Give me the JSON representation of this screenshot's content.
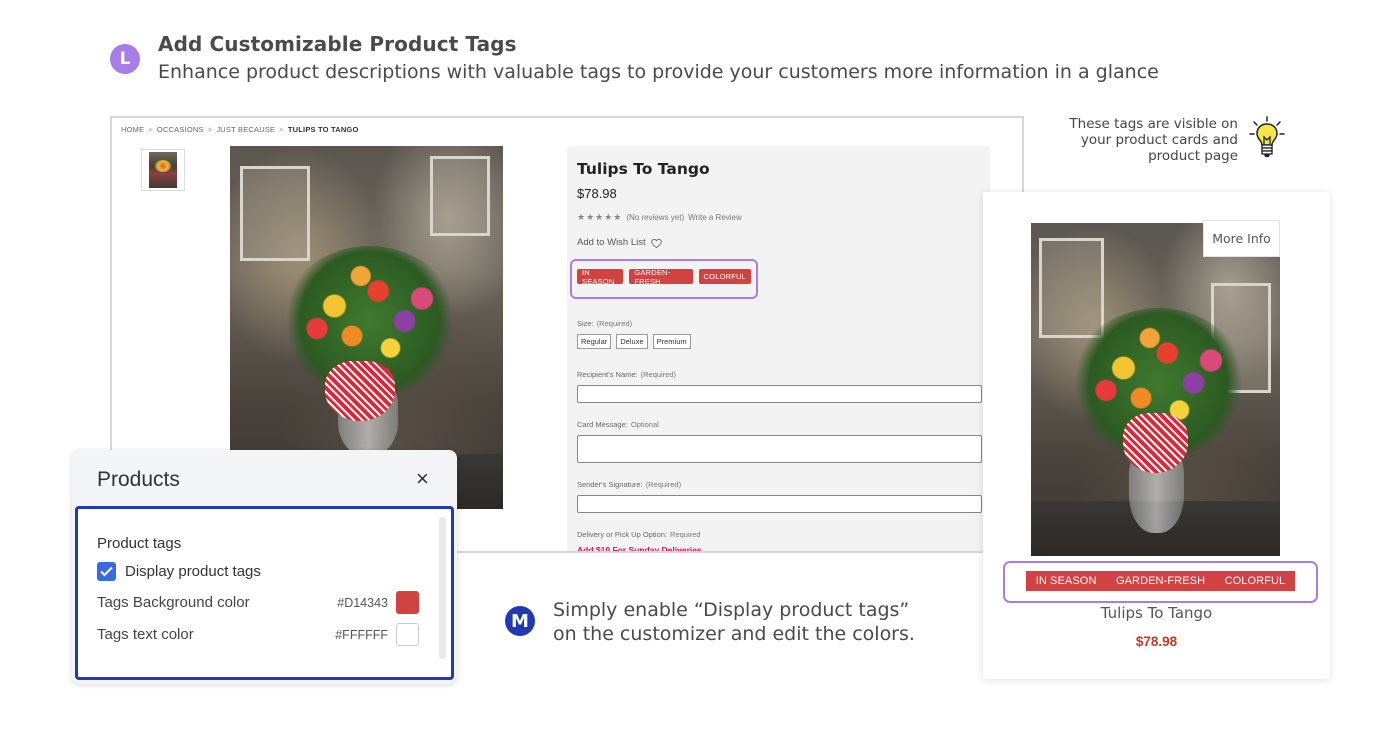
{
  "header": {
    "badge": "L",
    "title": "Add Customizable Product Tags",
    "subtitle": "Enhance product descriptions with valuable tags to provide your customers more information in a glance"
  },
  "product_page": {
    "breadcrumb": [
      "HOME",
      "OCCASIONS",
      "JUST BECAUSE",
      "TULIPS TO TANGO"
    ],
    "breadcrumb_separator": ">",
    "name": "Tulips To Tango",
    "price": "$78.98",
    "stars": "★★★★★",
    "reviews": "(No reviews yet)",
    "write_review": "Write a Review",
    "wish_list": "Add to Wish List",
    "tags": [
      "IN SEASON",
      "GARDEN-FRESH",
      "COLORFUL"
    ],
    "size_label": "Size:",
    "size_req": "(Required)",
    "size_options": [
      "Regular",
      "Deluxe",
      "Premium"
    ],
    "recipient_label": "Recipient's Name:",
    "recipient_req": "(Required)",
    "card_label": "Card Message:",
    "card_req": "Optional",
    "sender_label": "Sender's Signature:",
    "sender_req": "(Required)",
    "delivery_label": "Delivery or Pick Up Option:",
    "delivery_req": "Required",
    "sunday_note": "Add $10 For Sunday Deliveries"
  },
  "tip": {
    "text": "These tags are visible on your product cards and product page",
    "icon": "lightbulb-icon"
  },
  "product_card": {
    "more_info": "More Info",
    "tags": [
      "IN SEASON",
      "GARDEN-FRESH",
      "COLORFUL"
    ],
    "name": "Tulips To Tango",
    "price": "$78.98"
  },
  "customizer": {
    "title": "Products",
    "close": "×",
    "section": "Product tags",
    "checkbox_label": "Display product tags",
    "checkbox_checked": true,
    "bg_label": "Tags Background color",
    "bg_hex": "#D14343",
    "text_label": "Tags text color",
    "text_hex": "#FFFFFF"
  },
  "instruction": {
    "badge": "M",
    "line1": "Simply enable “Display product tags”",
    "line2": "on the customizer and edit the colors."
  },
  "colors": {
    "tag_bg": "#D14343",
    "tag_text": "#FFFFFF",
    "highlight": "#A77DE8",
    "accent_blue": "#2238B5",
    "price_red": "#C0392B",
    "sunday_pink": "#E0115F"
  }
}
